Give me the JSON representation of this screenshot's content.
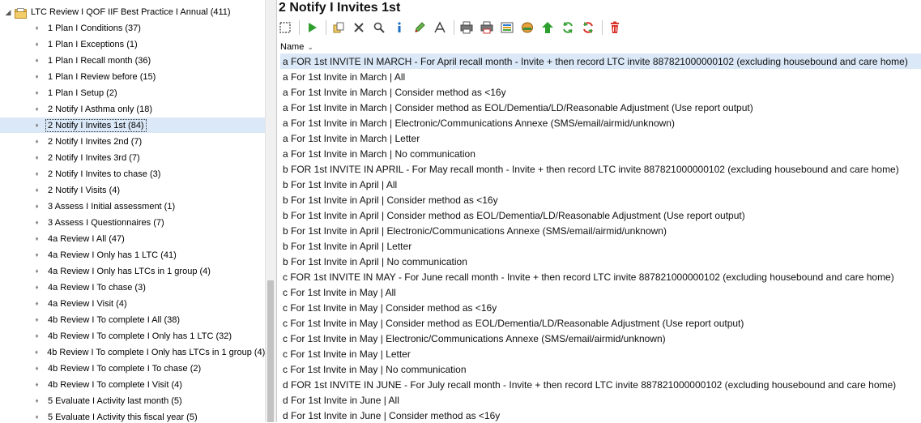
{
  "tree": {
    "root_label": "LTC Review I QOF IIF Best Practice I Annual (411)",
    "items": [
      {
        "label": "1 Plan I Conditions (37)"
      },
      {
        "label": "1 Plan I Exceptions (1)"
      },
      {
        "label": "1 Plan I Recall month (36)"
      },
      {
        "label": "1 Plan I Review before (15)"
      },
      {
        "label": "1 Plan I Setup (2)"
      },
      {
        "label": "2 Notify I Asthma only (18)"
      },
      {
        "label": "2 Notify I Invites 1st (84)",
        "selected": true
      },
      {
        "label": "2 Notify I Invites 2nd (7)"
      },
      {
        "label": "2 Notify I Invites 3rd (7)"
      },
      {
        "label": "2 Notify I Invites to chase (3)"
      },
      {
        "label": "2 Notify I Visits (4)"
      },
      {
        "label": "3 Assess I Initial assessment (1)"
      },
      {
        "label": "3 Assess I Questionnaires (7)"
      },
      {
        "label": "4a Review I All (47)"
      },
      {
        "label": "4a Review I Only has 1 LTC (41)"
      },
      {
        "label": "4a Review I Only has LTCs in 1 group (4)"
      },
      {
        "label": "4a Review I To chase (3)"
      },
      {
        "label": "4a Review I Visit (4)"
      },
      {
        "label": "4b Review I To complete I All (38)"
      },
      {
        "label": "4b Review I To complete I Only has 1 LTC (32)"
      },
      {
        "label": "4b Review I To complete I Only has LTCs in 1 group (4)"
      },
      {
        "label": "4b Review I To complete I To chase (2)"
      },
      {
        "label": "4b Review I To complete I Visit (4)"
      },
      {
        "label": "5 Evaluate I Activity last month (5)"
      },
      {
        "label": "5 Evaluate I Activity this fiscal year (5)"
      }
    ]
  },
  "panel": {
    "title": "2 Notify I Invites 1st",
    "column_header": "Name",
    "toolbar_icons": [
      "select-all-icon",
      "run-icon",
      "copy-icon",
      "close-icon",
      "search-icon",
      "info-icon",
      "edit-icon",
      "font-icon",
      "print-icon",
      "print-color-icon",
      "export-icon",
      "refresh-icon",
      "up-arrow-icon",
      "sync-icon",
      "sync-alt-icon",
      "delete-icon"
    ],
    "rows": [
      {
        "label": "a FOR 1st INVITE IN MARCH - For April recall month - Invite + then record LTC invite 887821000000102 (excluding housebound and care home)",
        "selected": true
      },
      {
        "label": "a For 1st Invite in March | All"
      },
      {
        "label": "a For 1st Invite in March | Consider method as <16y"
      },
      {
        "label": "a For 1st Invite in March | Consider method as EOL/Dementia/LD/Reasonable Adjustment (Use report output)"
      },
      {
        "label": "a For 1st Invite in March | Electronic/Communications Annexe (SMS/email/airmid/unknown)"
      },
      {
        "label": "a For 1st Invite in March | Letter"
      },
      {
        "label": "a For 1st Invite in March | No communication"
      },
      {
        "label": "b FOR 1st INVITE IN APRIL - For May recall month - Invite + then record LTC invite 887821000000102 (excluding housebound and care home)"
      },
      {
        "label": "b For 1st Invite in April | All"
      },
      {
        "label": "b For 1st Invite in April | Consider method as <16y"
      },
      {
        "label": "b For 1st Invite in April | Consider method as EOL/Dementia/LD/Reasonable Adjustment (Use report output)"
      },
      {
        "label": "b For 1st Invite in April | Electronic/Communications Annexe (SMS/email/airmid/unknown)"
      },
      {
        "label": "b For 1st Invite in April | Letter"
      },
      {
        "label": "b For 1st Invite in April | No communication"
      },
      {
        "label": "c FOR 1st INVITE IN MAY - For June recall month - Invite + then record LTC invite 887821000000102 (excluding housebound and care home)"
      },
      {
        "label": "c For 1st Invite in May | All"
      },
      {
        "label": "c For 1st Invite in May | Consider method as <16y"
      },
      {
        "label": "c For 1st Invite in May | Consider method as EOL/Dementia/LD/Reasonable Adjustment (Use report output)"
      },
      {
        "label": "c For 1st Invite in May | Electronic/Communications Annexe (SMS/email/airmid/unknown)"
      },
      {
        "label": "c For 1st Invite in May | Letter"
      },
      {
        "label": "c For 1st Invite in May | No communication"
      },
      {
        "label": "d FOR 1st INVITE IN JUNE - For July recall month - Invite + then record LTC invite 887821000000102 (excluding housebound and care home)"
      },
      {
        "label": "d For 1st Invite in June | All"
      },
      {
        "label": "d For 1st Invite in June | Consider method as <16y"
      }
    ]
  },
  "colors": {
    "selection": "#dbe8f7",
    "run_green": "#2e9e2e",
    "delete_red": "#d9342b",
    "folder": "#e5b84e"
  }
}
